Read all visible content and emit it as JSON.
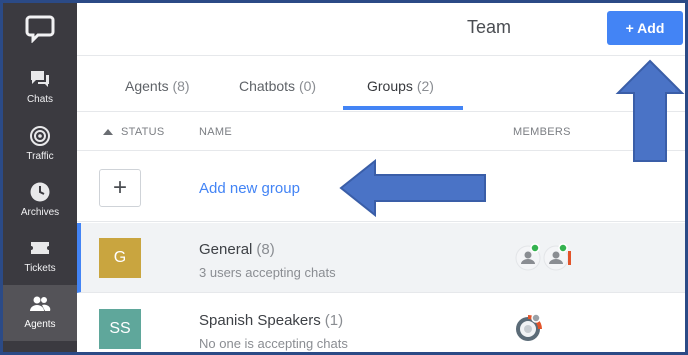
{
  "sidebar": {
    "items": [
      {
        "label": "Chats",
        "icon": "chats-icon"
      },
      {
        "label": "Traffic",
        "icon": "traffic-icon"
      },
      {
        "label": "Archives",
        "icon": "archives-icon"
      },
      {
        "label": "Tickets",
        "icon": "tickets-icon"
      },
      {
        "label": "Agents",
        "icon": "agents-icon",
        "active": true
      }
    ]
  },
  "header": {
    "title": "Team",
    "add_button": "+ Add"
  },
  "tabs": [
    {
      "label": "Agents",
      "count": "(8)"
    },
    {
      "label": "Chatbots",
      "count": "(0)"
    },
    {
      "label": "Groups",
      "count": "(2)",
      "active": true
    }
  ],
  "columns": {
    "status": "STATUS",
    "name": "NAME",
    "members": "MEMBERS"
  },
  "add_group": {
    "icon": "+",
    "label": "Add new group"
  },
  "groups": [
    {
      "initials": "G",
      "name": "General",
      "count": "(8)",
      "status": "3 users accepting chats",
      "color": "#c9a53f"
    },
    {
      "initials": "SS",
      "name": "Spanish Speakers",
      "count": "(1)",
      "status": "No one is accepting chats",
      "color": "#5fa79b"
    }
  ],
  "colors": {
    "accent": "#4384f5",
    "sidebar": "#3b3a40",
    "annotation_arrow": "#4a73c6",
    "online_dot": "#34b24f"
  }
}
